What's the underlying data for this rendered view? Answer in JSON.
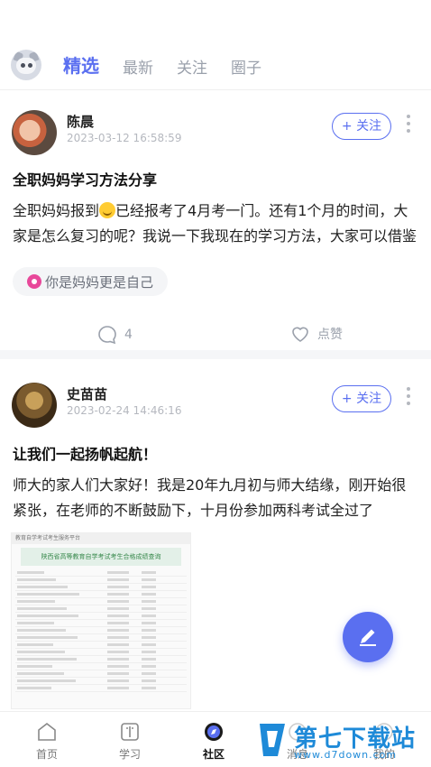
{
  "tabs": [
    "精选",
    "最新",
    "关注",
    "圈子"
  ],
  "posts": [
    {
      "author": "陈晨",
      "time": "2023-03-12 16:58:59",
      "follow_label": "+ 关注",
      "title": "全职妈妈学习方法分享",
      "body_before_emoji": "全职妈妈报到",
      "body_after_emoji": "已经报考了4月考一门。还有1个月的时间，大家是怎么复习的呢？我说一下我现在的学习方法，大家可以借鉴",
      "emoji": "smiling-face-icon",
      "tag": "你是妈妈更是自己",
      "comment_count": "4",
      "like_label": "点赞"
    },
    {
      "author": "史苗苗",
      "time": "2023-02-24 14:46:16",
      "follow_label": "+ 关注",
      "title": "让我们一起扬帆起航！",
      "body": "师大的家人们大家好！我是20年九月初与师大结缘，刚开始很紧张，在老师的不断鼓励下，十月份参加两科考试全过了",
      "image_header": "教育自学考试考生服务平台",
      "image_banner": "陕西省高等教育自学考试考生合格成绩查询"
    }
  ],
  "bottom_nav": [
    "首页",
    "学习",
    "社区",
    "消息",
    "我的"
  ],
  "watermark": {
    "name": "第七下载站",
    "url": "www.d7down.com"
  },
  "colors": {
    "accent": "#5a6ff0",
    "watermark": "#1e8ad8"
  }
}
